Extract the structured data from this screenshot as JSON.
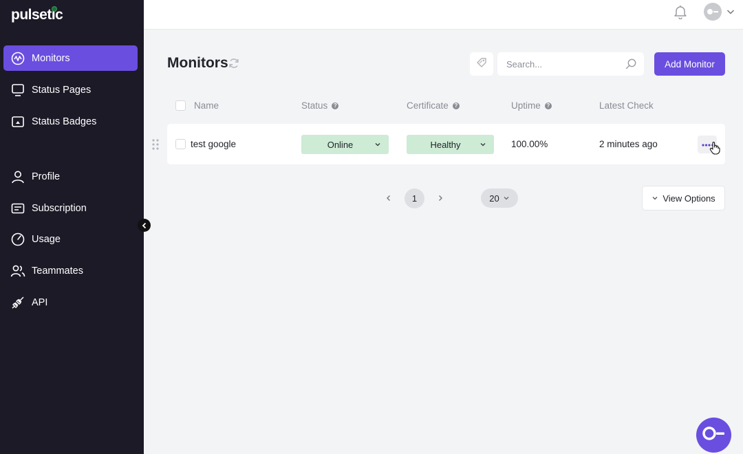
{
  "app": {
    "name": "pulsetic"
  },
  "sidebar": {
    "items": [
      {
        "label": "Monitors",
        "icon": "monitor-pulse-icon",
        "active": true
      },
      {
        "label": "Status Pages",
        "icon": "display-icon",
        "active": false
      },
      {
        "label": "Status Badges",
        "icon": "badge-icon",
        "active": false
      },
      {
        "label": "Profile",
        "icon": "user-icon",
        "active": false
      },
      {
        "label": "Subscription",
        "icon": "card-icon",
        "active": false
      },
      {
        "label": "Usage",
        "icon": "gauge-icon",
        "active": false
      },
      {
        "label": "Teammates",
        "icon": "users-icon",
        "active": false
      },
      {
        "label": "API",
        "icon": "plug-icon",
        "active": false
      }
    ]
  },
  "header": {
    "bell_icon": "bell-icon",
    "avatar_icon": "user-avatar-icon"
  },
  "page": {
    "title": "Monitors",
    "search_placeholder": "Search...",
    "add_button": "Add Monitor"
  },
  "table": {
    "columns": [
      "Name",
      "Status",
      "Certificate",
      "Uptime",
      "Latest Check"
    ],
    "rows": [
      {
        "name": "test google",
        "status": "Online",
        "certificate": "Healthy",
        "uptime": "100.00%",
        "latest_check": "2 minutes ago"
      }
    ]
  },
  "pagination": {
    "current_page": "1",
    "page_size": "20",
    "view_options": "View Options"
  },
  "colors": {
    "accent": "#6a4ee0",
    "sidebar_bg": "#1c1a27",
    "status_ok": "#cdebd5"
  }
}
